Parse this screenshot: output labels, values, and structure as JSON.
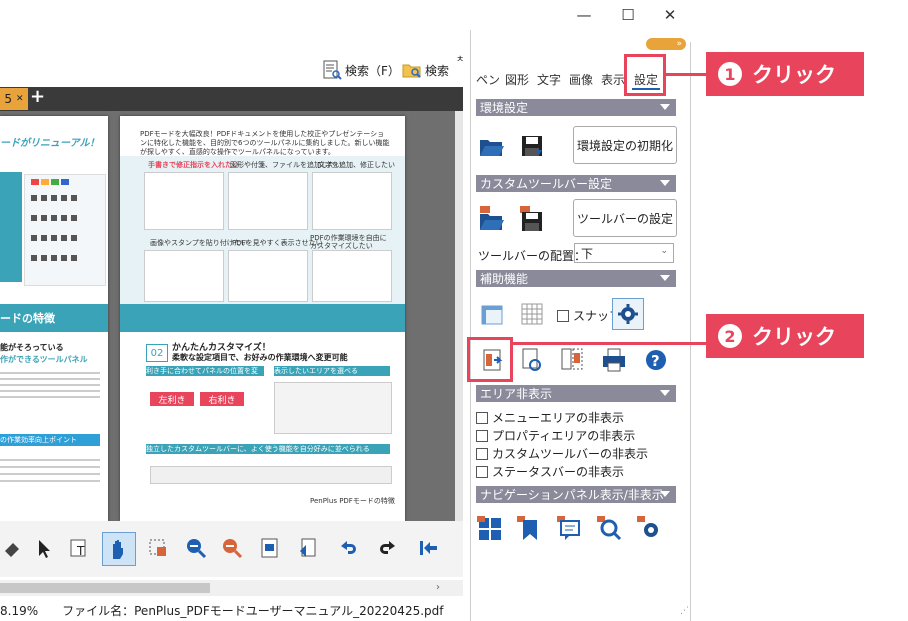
{
  "window": {
    "minimize": "—",
    "maximize": "☐",
    "close": "✕"
  },
  "toolbar": {
    "search_label": "検索（F）",
    "search2_label": "検索",
    "toggle_label": "»"
  },
  "tab": {
    "label": "5",
    "plus": "+"
  },
  "document": {
    "left_page": {
      "banner": "ードがリニューアル！",
      "heading": "ードの特徴",
      "line1": "能がそろっている",
      "line2": "作ができるツールパネル",
      "highlight": "の作業効率向上ポイント"
    },
    "right_page": {
      "intro": "PDFモードを大幅改良！PDFドキュメントを使用した校正やプレゼンテーションに特化した機能を、目的別で6つのツールパネルに集約しました。新しい機能が探しやすく、直感的な操作でツールパネルになっています。",
      "tag1": "手書きで修正指示を入れたい",
      "tag2": "図形や付箋、ファイルを追加したい",
      "tag3": "文字を追加、修正したい",
      "tag4": "画像やスタンプを貼り付けたい",
      "tag5": "PDFを見やすく表示させたい",
      "tag6": "PDFの作業環境を自由にカスタマイズしたい",
      "section_num": "02",
      "section_title": "かんたんカスタマイズ！",
      "section_sub": "柔軟な設定項目で、お好みの作業環境へ変更可能",
      "bar1": "利き手に合わせてパネルの位置を変える",
      "bar2": "表示したいエリアを選べる",
      "left_hand": "左利き",
      "right_hand": "右利き",
      "bar3": "独立したカスタムツールバーに、よく使う機能を自分好みに並べられる",
      "footer": "PenPlus PDFモードの特徴"
    }
  },
  "status": {
    "zoom": "8.19%",
    "filename": "ファイル名：PenPlus_PDFモードユーザーマニュアル_20220425.pdf"
  },
  "panel": {
    "tabs": [
      "ペン",
      "図形",
      "文字",
      "画像",
      "表示",
      "設定"
    ],
    "active_tab": "設定",
    "sections": {
      "env": "環境設定",
      "custom_toolbar": "カスタムツールバー設定",
      "assist": "補助機能",
      "area_hide": "エリア非表示",
      "nav_panel": "ナビゲーションパネル表示/非表示"
    },
    "reset_button": "環境設定の初期化",
    "toolbar_settings_button": "ツールバーの設定",
    "toolbar_position_label": "ツールバーの配置：",
    "toolbar_position_value": "下",
    "snap_label": "スナップ",
    "hide_options": [
      "メニューエリアの非表示",
      "プロパティエリアの非表示",
      "カスタムツールバーの非表示",
      "ステータスバーの非表示"
    ]
  },
  "callouts": {
    "c1_num": "1",
    "c1_text": "クリック",
    "c2_num": "2",
    "c2_text": "クリック"
  },
  "colors": {
    "accent": "#e8455c",
    "section": "#8a8a9a",
    "doc_bg": "#6f6f6f",
    "tab": "#e8a33a",
    "teal": "#3aa3b8"
  }
}
